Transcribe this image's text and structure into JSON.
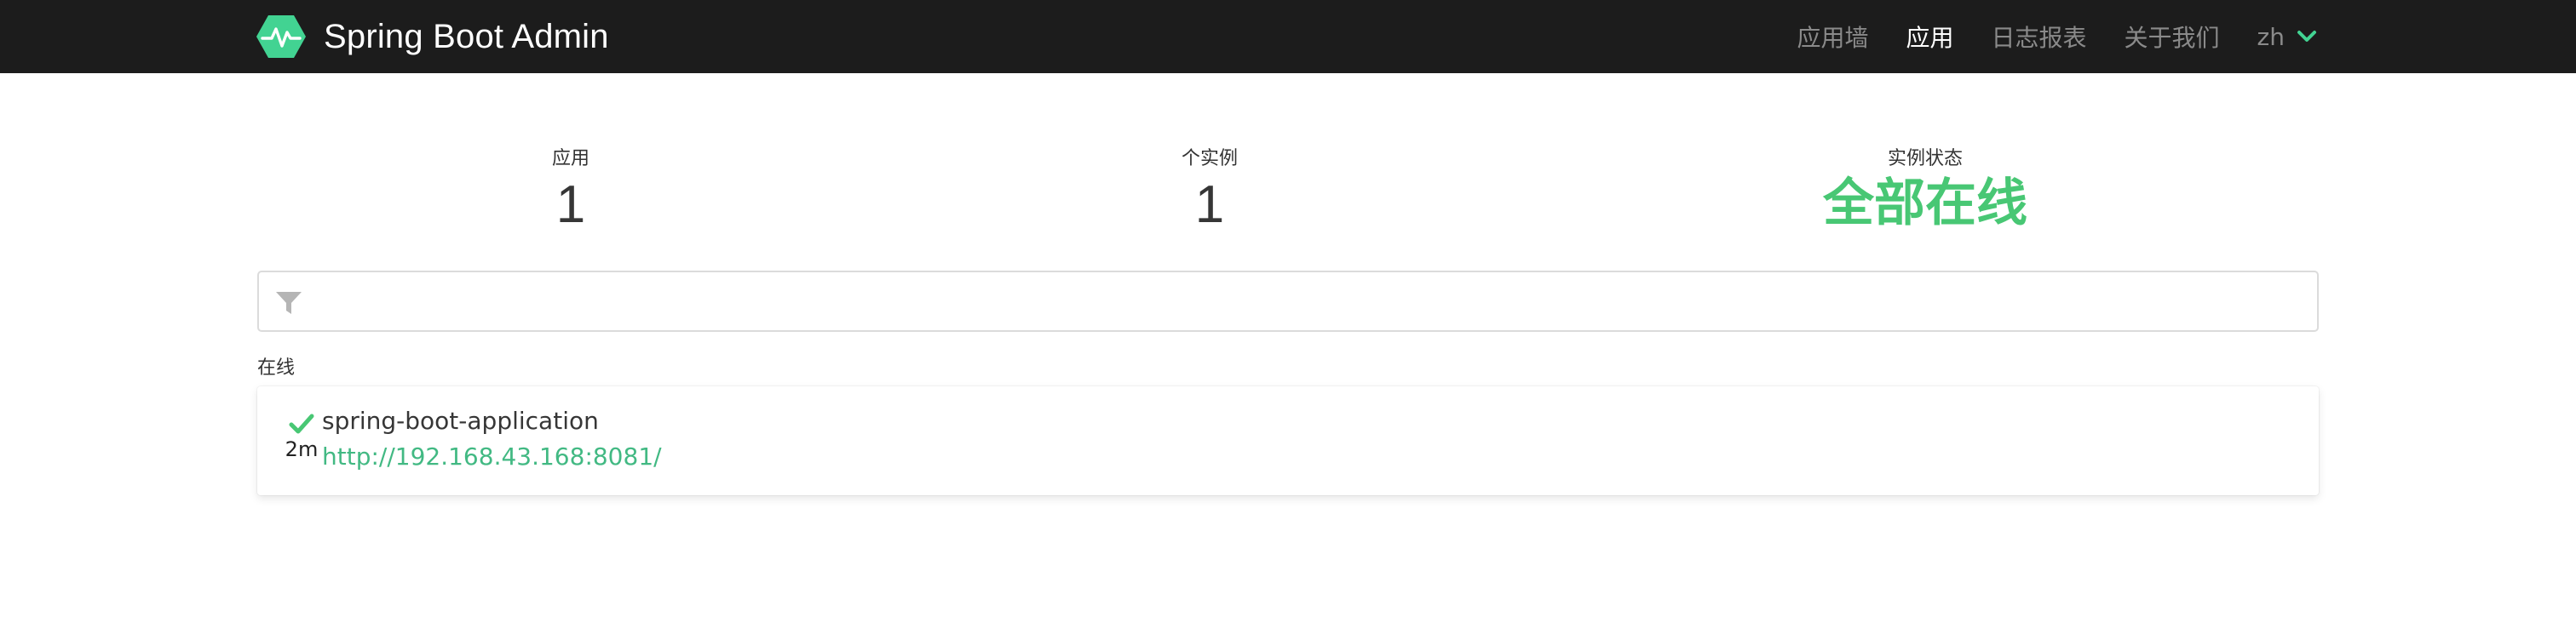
{
  "header": {
    "brand": "Spring Boot Admin",
    "nav": [
      {
        "label": "应用墙",
        "active": false
      },
      {
        "label": "应用",
        "active": true
      },
      {
        "label": "日志报表",
        "active": false
      },
      {
        "label": "关于我们",
        "active": false
      }
    ],
    "language": "zh"
  },
  "stats": {
    "applications": {
      "label": "应用",
      "value": "1"
    },
    "instances": {
      "label": "个实例",
      "value": "1"
    },
    "status": {
      "label": "实例状态",
      "value": "全部在线"
    }
  },
  "filter": {
    "value": "",
    "placeholder": ""
  },
  "groups": [
    {
      "title": "在线",
      "applications": [
        {
          "status": "UP",
          "uptime": "2m",
          "name": "spring-boot-application",
          "url": "http://192.168.43.168:8081/"
        }
      ]
    }
  ],
  "colors": {
    "navbar": "#1c1c1c",
    "accent": "#42b983",
    "status_up": "#48c774",
    "logo": "#42d392"
  },
  "icons": {
    "brand": "heartbeat-hexagon-icon",
    "language": "chevron-down-icon",
    "filter": "filter-icon",
    "status": "check-icon"
  }
}
